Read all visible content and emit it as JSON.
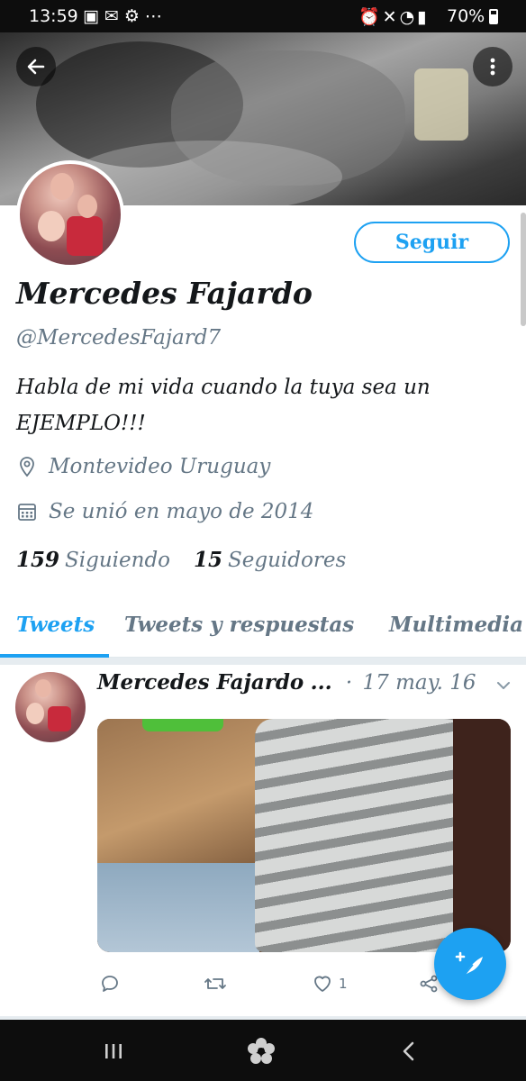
{
  "status_bar": {
    "time": "13:59",
    "battery": "70%",
    "left_icons": [
      "image-icon",
      "mail-icon",
      "settings-icon",
      "more-icon"
    ],
    "right_icons": [
      "alarm-icon",
      "mute-icon",
      "wifi-icon",
      "signal-icon",
      "battery-icon"
    ]
  },
  "profile": {
    "name": "Mercedes Fajardo",
    "handle": "@MercedesFajard7",
    "bio": "Habla de mi vida cuando la tuya sea un EJEMPLO!!!",
    "location": "Montevideo Uruguay",
    "joined": "Se unió en mayo de 2014",
    "following_count": "159",
    "following_label": "Siguiendo",
    "followers_count": "15",
    "followers_label": "Seguidores",
    "follow_button": "Seguir"
  },
  "tabs": [
    {
      "label": "Tweets",
      "active": true
    },
    {
      "label": "Tweets y respuestas",
      "active": false
    },
    {
      "label": "Multimedia",
      "active": false
    }
  ],
  "tweet": {
    "author": "Mercedes Fajardo",
    "ellipsis": "...",
    "separator": "·",
    "date": "17 may. 16",
    "likes": "1"
  },
  "colors": {
    "accent": "#1da1f2",
    "text": "#14171a",
    "muted": "#657786"
  }
}
